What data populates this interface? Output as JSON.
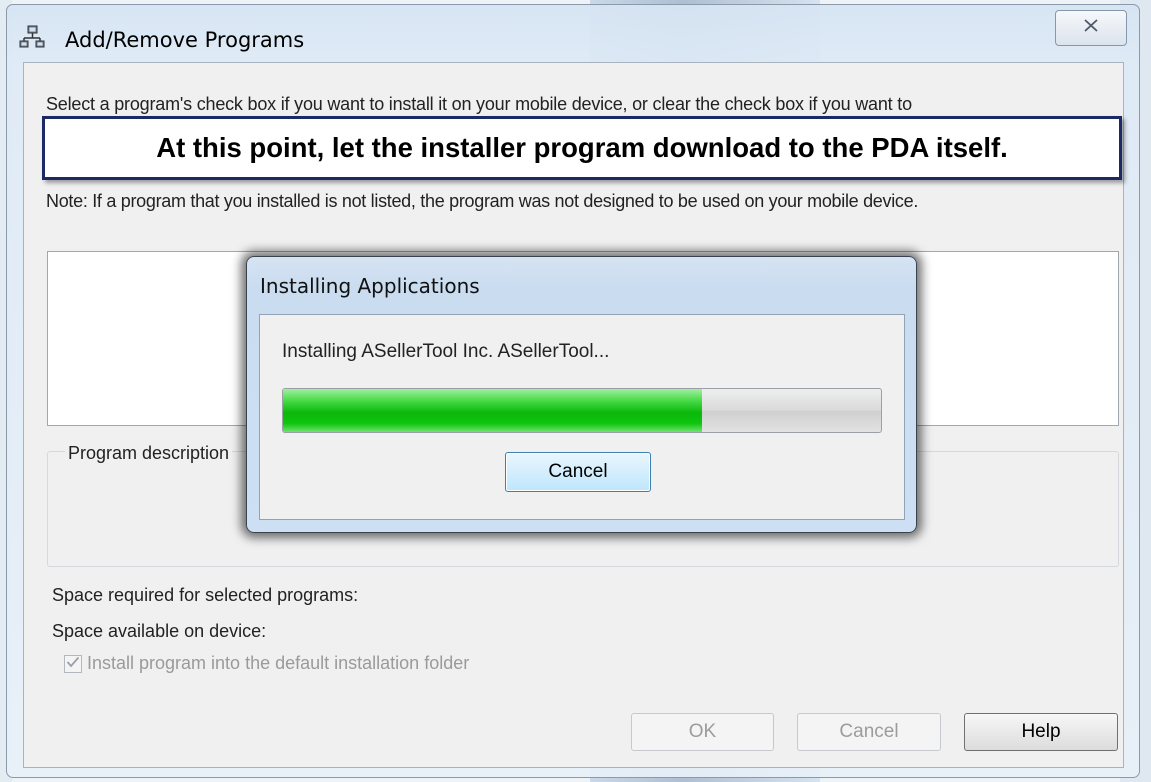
{
  "window": {
    "title": "Add/Remove Programs",
    "close_symbol": "✕"
  },
  "main": {
    "instruction": "Select a program's check box if you want to install it on your mobile device, or clear the check box if you want to",
    "callout": "At this point, let the installer program download to the PDA itself.",
    "note": "Note:  If a program that you installed is not listed, the program was not designed to be used on your mobile device.",
    "description_group_label": "Program description",
    "space_required_label": "Space required for selected programs:",
    "space_available_label": "Space available on device:",
    "default_folder_checkbox": {
      "label": "Install program into the default installation folder",
      "checked": true,
      "enabled": false
    },
    "buttons": {
      "ok": "OK",
      "cancel": "Cancel",
      "help": "Help"
    }
  },
  "dialog": {
    "title": "Installing Applications",
    "status": "Installing ASellerTool Inc. ASellerTool...",
    "progress_percent": 70,
    "cancel_label": "Cancel"
  },
  "icons": {
    "window_icon": "network-computers-icon",
    "close_icon": "close-icon",
    "check_icon": "checkmark-icon"
  },
  "colors": {
    "progress_green": "#0bb80b",
    "callout_border": "#1b2a66",
    "focused_button_border": "#3c7fb1"
  }
}
